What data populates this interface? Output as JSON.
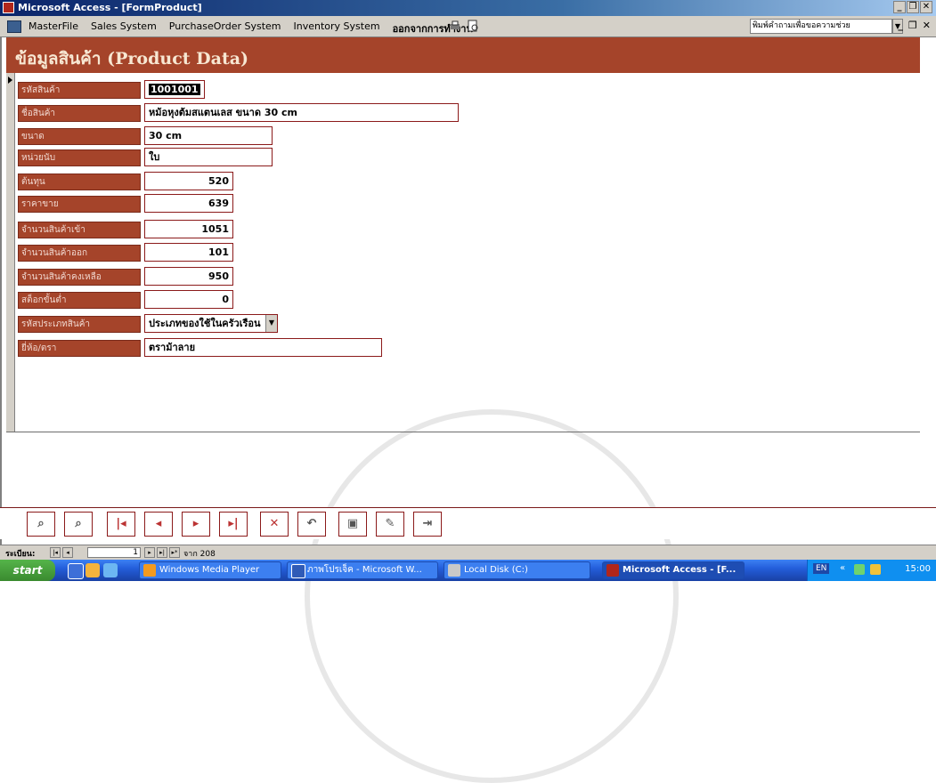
{
  "window": {
    "title": "Microsoft Access - [FormProduct]",
    "controls": [
      "_",
      "❐",
      "✕"
    ]
  },
  "menubar": {
    "items": [
      "MasterFile",
      "Sales System",
      "PurchaseOrder System",
      "Inventory System",
      "ออกจากการทำงาน"
    ],
    "help_box": "พิมพ์คำถามเพื่อขอความช่วย",
    "mdi_controls": [
      "_",
      "❐",
      "✕"
    ]
  },
  "form": {
    "header_title": "ข้อมูลสินค้า (Product Data)",
    "fields": [
      {
        "label": "รหัสสินค้า",
        "value": "1001001",
        "kind": "selected"
      },
      {
        "label": "ชื่อสินค้า",
        "value": "หม้อหุงต้มสแตนเลส ขนาด 30 cm",
        "kind": "text"
      },
      {
        "label": "ขนาด",
        "value": "30 cm",
        "kind": "text"
      },
      {
        "label": "หน่วยนับ",
        "value": "ใบ",
        "kind": "text"
      },
      {
        "label": "ต้นทุน",
        "value": "520",
        "kind": "num"
      },
      {
        "label": "ราคาขาย",
        "value": "639",
        "kind": "num"
      },
      {
        "label": "จำนวนสินค้าเข้า",
        "value": "1051",
        "kind": "num"
      },
      {
        "label": "จำนวนสินค้าออก",
        "value": "101",
        "kind": "num"
      },
      {
        "label": "จำนวนสินค้าคงเหลือ",
        "value": "950",
        "kind": "num"
      },
      {
        "label": "สต็อกขั้นต่ำ",
        "value": "0",
        "kind": "num"
      },
      {
        "label": "รหัสประเภทสินค้า",
        "value": "ประเภทของใช้ในครัวเรือน",
        "kind": "combo"
      },
      {
        "label": "ยี่ห้อ/ตรา",
        "value": "ตราม้าลาย",
        "kind": "text"
      }
    ]
  },
  "nav_buttons": [
    "find-icon",
    "find-next-icon",
    "first-record-icon",
    "prev-record-icon",
    "next-record-icon",
    "last-record-icon",
    "delete-record-icon",
    "undo-icon",
    "save-icon",
    "edit-icon",
    "exit-icon"
  ],
  "recordbar": {
    "label": "ระเบียน:",
    "current": "1",
    "of_text": "จาก 208"
  },
  "taskbar": {
    "start": "start",
    "tasks": [
      {
        "label": "Windows Media Player",
        "active": false
      },
      {
        "label": "ภาพโปรเจ็ค - Microsoft W...",
        "active": false
      },
      {
        "label": "Local Disk (C:)",
        "active": false
      },
      {
        "label": "Microsoft Access - [F...",
        "active": true
      }
    ],
    "tray_lang": "EN",
    "clock": "15:00"
  },
  "colors": {
    "form_brown": "#a5442a",
    "field_border": "#8b1a1a",
    "header_text": "#f7e7d2"
  }
}
